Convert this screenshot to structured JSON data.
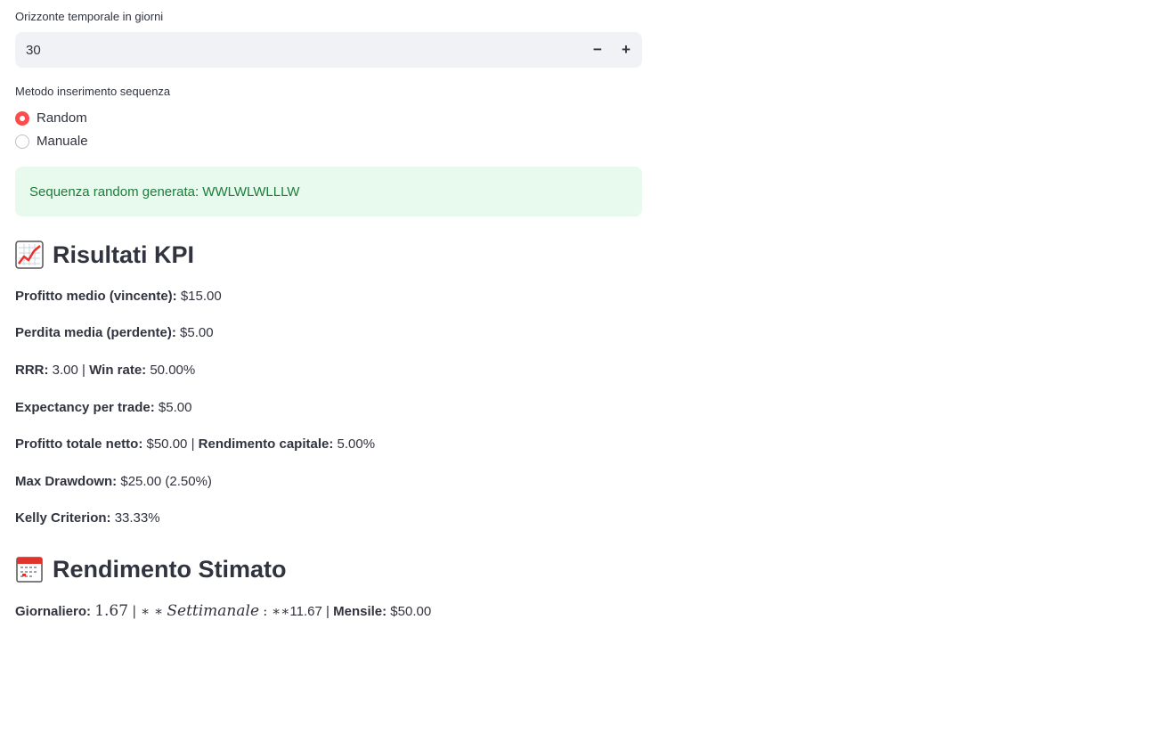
{
  "horizon": {
    "label": "Orizzonte temporale in giorni",
    "value": "30",
    "minus": "−",
    "plus": "+"
  },
  "method": {
    "label": "Metodo inserimento sequenza",
    "options": [
      {
        "label": "Random",
        "selected": true
      },
      {
        "label": "Manuale",
        "selected": false
      }
    ]
  },
  "alert": {
    "text": "Sequenza random generata: WWLWLWLLLW"
  },
  "kpi": {
    "title": "Risultati KPI",
    "icon": "chart-increasing-icon",
    "profit_avg_label": "Profitto medio (vincente):",
    "profit_avg_value": "$15.00",
    "loss_avg_label": "Perdita media (perdente):",
    "loss_avg_value": "$5.00",
    "rrr_label": "RRR:",
    "rrr_value": "3.00",
    "winrate_label": "Win rate:",
    "winrate_value": "50.00%",
    "expectancy_label": "Expectancy per trade:",
    "expectancy_value": "$5.00",
    "net_profit_label": "Profitto totale netto:",
    "net_profit_value": "$50.00",
    "capital_return_label": "Rendimento capitale:",
    "capital_return_value": "5.00%",
    "drawdown_label": "Max Drawdown:",
    "drawdown_value": "$25.00 (2.50%)",
    "kelly_label": "Kelly Criterion:",
    "kelly_value": "33.33%",
    "separator": "|"
  },
  "estimate": {
    "title": "Rendimento Stimato",
    "icon": "calendar-icon",
    "daily_label": "Giornaliero:",
    "daily_math": "1.67",
    "mid_math_1": "| ∗ ∗",
    "weekly_math": "Settimanale",
    "mid_math_2": ": ∗∗",
    "weekly_value": "11.67",
    "separator": "|",
    "monthly_label": "Mensile:",
    "monthly_value": "$50.00"
  }
}
